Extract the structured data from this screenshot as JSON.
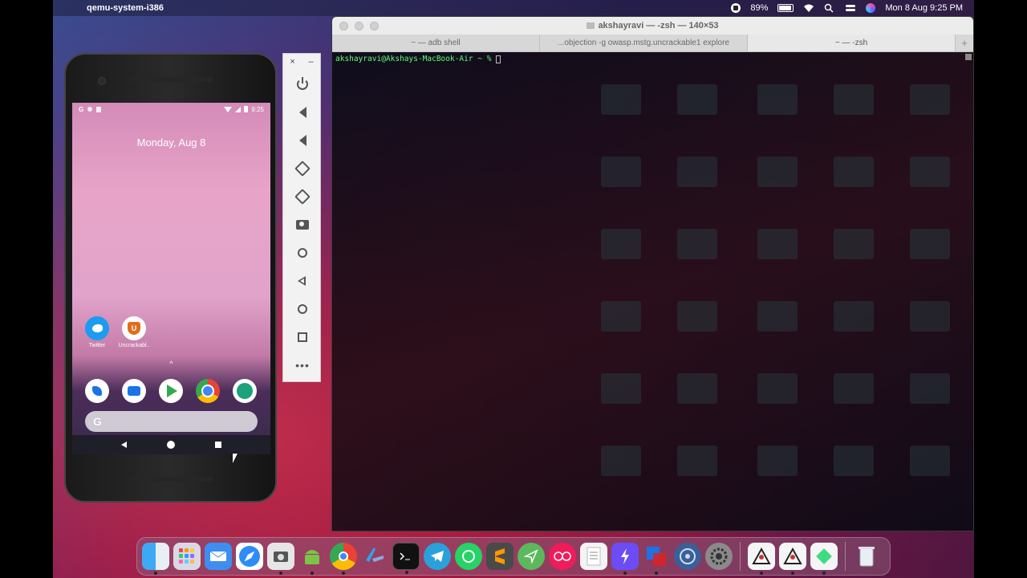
{
  "menubar": {
    "app_name": "qemu-system-i386",
    "battery": "89%",
    "datetime": "Mon 8 Aug  9:25 PM"
  },
  "phone": {
    "status_time": "9:25",
    "status_g": "G",
    "date": "Monday, Aug 8",
    "apps": [
      {
        "label": "Twitter",
        "icon": "twitter-icon"
      },
      {
        "label": "Uncrackabl..",
        "icon": "uncrackable-app-icon"
      }
    ],
    "drawer_arrow": "^",
    "dock_apps": [
      "phone-icon",
      "messages-icon",
      "play-store-icon",
      "chrome-icon",
      "app-icon"
    ],
    "search_g": "G"
  },
  "emulator_toolbar": {
    "close": "×",
    "minimize": "–",
    "more": "•••"
  },
  "terminal": {
    "title": "akshayravi — -zsh — 140×53",
    "tabs": [
      {
        "label": "~ — adb shell",
        "active": false
      },
      {
        "label": "...objection -g owasp.mstg.uncrackable1 explore",
        "active": false
      },
      {
        "label": "~ — -zsh",
        "active": true
      }
    ],
    "add_tab": "+",
    "prompt": "akshayravi@Akshays-MacBook-Air ~ % "
  },
  "dock": {
    "items": [
      "finder-icon",
      "launchpad-icon",
      "mail-icon",
      "safari-icon",
      "screenshot-icon",
      "android-studio-icon",
      "chrome-icon",
      "xcode-icon",
      "terminal-icon",
      "telegram-icon",
      "whatsapp-icon",
      "sublime-icon",
      "send-icon",
      "flickr-icon",
      "textedit-icon",
      "shortcuts-icon",
      "vmware-icon",
      "network-icon",
      "system-preferences-icon",
      "java-icon",
      "java-icon-2",
      "android-sdk-icon",
      "trash-icon"
    ]
  },
  "colors": {
    "terminal_text": "#4aff6a",
    "twitter_blue": "#1d9bf0"
  }
}
